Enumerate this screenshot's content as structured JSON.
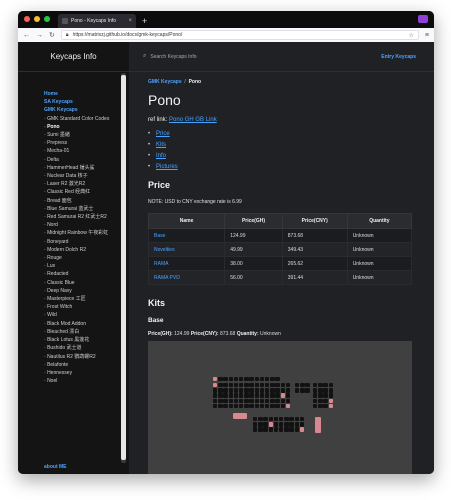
{
  "browser": {
    "tab_title": "Pono - Keycaps Info",
    "tab_close": "×",
    "new_tab": "+",
    "url": "https://matrixzj.github.io/docs/gmk-keycaps/Pono/",
    "nav_back": "←",
    "nav_forward": "→",
    "nav_reload": "↻",
    "menu": "≡",
    "star": "☆",
    "traffic_colors": [
      "#ff5f57",
      "#febc2e",
      "#28c840"
    ]
  },
  "sidebar": {
    "title": "Keycaps Info",
    "items": [
      {
        "label": "Home",
        "type": "link"
      },
      {
        "label": "SA Keycaps",
        "type": "link"
      },
      {
        "label": "GMK Keycaps",
        "type": "link"
      },
      {
        "label": "GMK Standard Color Codes",
        "type": "sub"
      },
      {
        "label": "Pono",
        "type": "active"
      },
      {
        "label": "Sumi 墨緒",
        "type": "sub"
      },
      {
        "label": "Prepress",
        "type": "sub"
      },
      {
        "label": "Mecha-01",
        "type": "sub"
      },
      {
        "label": "Delta",
        "type": "sub"
      },
      {
        "label": "HammerHead 锤头鲨",
        "type": "sub"
      },
      {
        "label": "Nuclear Data 核子",
        "type": "sub"
      },
      {
        "label": "Laser R2 激光R2",
        "type": "sub"
      },
      {
        "label": "Classic Red 经典红",
        "type": "sub"
      },
      {
        "label": "Bread 面包",
        "type": "sub"
      },
      {
        "label": "Blue Samurai 蓝武士",
        "type": "sub"
      },
      {
        "label": "Red Samurai R2 红武士R2",
        "type": "sub"
      },
      {
        "label": "Nord",
        "type": "sub"
      },
      {
        "label": "Midnight Rainbow 午夜彩虹",
        "type": "sub"
      },
      {
        "label": "Boneyard",
        "type": "sub"
      },
      {
        "label": "Modern Dolch R2",
        "type": "sub"
      },
      {
        "label": "Rouge",
        "type": "sub"
      },
      {
        "label": "Lux",
        "type": "sub"
      },
      {
        "label": "Redacted",
        "type": "sub"
      },
      {
        "label": "Classic Blue",
        "type": "sub"
      },
      {
        "label": "Deep Navy",
        "type": "sub"
      },
      {
        "label": "Masterpiece 工匠",
        "type": "sub"
      },
      {
        "label": "Frost Witch",
        "type": "sub"
      },
      {
        "label": "Wild",
        "type": "sub"
      },
      {
        "label": "Black Mod Addon",
        "type": "sub"
      },
      {
        "label": "Bleached 漂白",
        "type": "sub"
      },
      {
        "label": "Black Lotus 黑莲花",
        "type": "sub"
      },
      {
        "label": "Bushido 武士道",
        "type": "sub"
      },
      {
        "label": "Nautilus R2 鹦鹉螺R2",
        "type": "sub"
      },
      {
        "label": "Belafonte",
        "type": "sub"
      },
      {
        "label": "Hennessey",
        "type": "sub"
      },
      {
        "label": "Noel",
        "type": "sub"
      }
    ],
    "about": "about ME"
  },
  "topbar": {
    "search_icon": "⌕",
    "search_placeholder": "Search Keycaps Info",
    "entry_link": "Entry Keycaps"
  },
  "breadcrumb": {
    "parent": "GMK Keycaps",
    "separator": "/",
    "current": "Pono"
  },
  "page": {
    "title": "Pono",
    "ref_label": "ref link:",
    "ref_link": "Pono GH GB Link",
    "toc": [
      "Price",
      "Kits",
      "Info",
      "Pictures"
    ],
    "price_heading": "Price",
    "note": "NOTE: USD to CNY exchange rate is 6.99",
    "table": {
      "headers": [
        "Name",
        "Price(GH)",
        "Price(CNY)",
        "Quantity"
      ],
      "rows": [
        [
          "Base",
          "124.99",
          "873.68",
          "Unknown"
        ],
        [
          "Novelties",
          "49.99",
          "349.43",
          "Unknown"
        ],
        [
          "RAMA",
          "38.00",
          "265.62",
          "Unknown"
        ],
        [
          "RAMA PVD",
          "56.00",
          "391.44",
          "Unknown"
        ]
      ]
    },
    "kits_heading": "Kits",
    "base_heading": "Base",
    "specs": {
      "price_gh_label": "Price(GH):",
      "price_gh": "124.99",
      "price_cny_label": "Price(CNY):",
      "price_cny": "873.68",
      "quantity_label": "Quantity:",
      "quantity": "Unknown"
    }
  },
  "colors": {
    "accent_link": "#4aa3ff",
    "accent_keycap": "#d8888f"
  }
}
